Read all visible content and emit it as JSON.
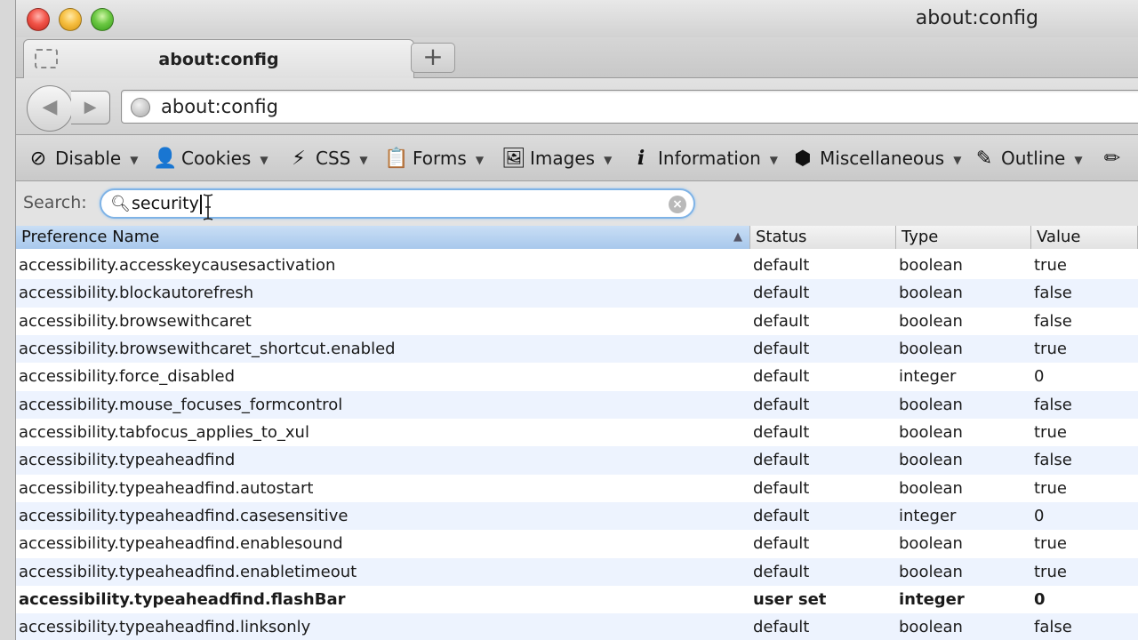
{
  "window": {
    "title": "about:config"
  },
  "tabs": [
    {
      "label": "about:config",
      "active": true
    }
  ],
  "new_tab_label": "+",
  "nav": {
    "back_glyph": "◀",
    "forward_glyph": "▶",
    "url": "about:config"
  },
  "dev_toolbar": {
    "items": [
      {
        "label": "Disable",
        "icon": "disable-icon"
      },
      {
        "label": "Cookies",
        "icon": "person-icon"
      },
      {
        "label": "CSS",
        "icon": "wand-icon"
      },
      {
        "label": "Forms",
        "icon": "clipboard-icon"
      },
      {
        "label": "Images",
        "icon": "image-icon"
      },
      {
        "label": "Information",
        "icon": "info-icon"
      },
      {
        "label": "Miscellaneous",
        "icon": "box-icon"
      },
      {
        "label": "Outline",
        "icon": "pencil-icon"
      }
    ]
  },
  "search": {
    "label": "Search:",
    "value": "security"
  },
  "table": {
    "columns": [
      "Preference Name",
      "Status",
      "Type",
      "Value"
    ],
    "rows": [
      {
        "name": "accessibility.accesskeycausesactivation",
        "status": "default",
        "type": "boolean",
        "value": "true"
      },
      {
        "name": "accessibility.blockautorefresh",
        "status": "default",
        "type": "boolean",
        "value": "false"
      },
      {
        "name": "accessibility.browsewithcaret",
        "status": "default",
        "type": "boolean",
        "value": "false"
      },
      {
        "name": "accessibility.browsewithcaret_shortcut.enabled",
        "status": "default",
        "type": "boolean",
        "value": "true"
      },
      {
        "name": "accessibility.force_disabled",
        "status": "default",
        "type": "integer",
        "value": "0"
      },
      {
        "name": "accessibility.mouse_focuses_formcontrol",
        "status": "default",
        "type": "boolean",
        "value": "false"
      },
      {
        "name": "accessibility.tabfocus_applies_to_xul",
        "status": "default",
        "type": "boolean",
        "value": "true"
      },
      {
        "name": "accessibility.typeaheadfind",
        "status": "default",
        "type": "boolean",
        "value": "false"
      },
      {
        "name": "accessibility.typeaheadfind.autostart",
        "status": "default",
        "type": "boolean",
        "value": "true"
      },
      {
        "name": "accessibility.typeaheadfind.casesensitive",
        "status": "default",
        "type": "integer",
        "value": "0"
      },
      {
        "name": "accessibility.typeaheadfind.enablesound",
        "status": "default",
        "type": "boolean",
        "value": "true"
      },
      {
        "name": "accessibility.typeaheadfind.enabletimeout",
        "status": "default",
        "type": "boolean",
        "value": "true"
      },
      {
        "name": "accessibility.typeaheadfind.flashBar",
        "status": "user set",
        "type": "integer",
        "value": "0"
      },
      {
        "name": "accessibility.typeaheadfind.linksonly",
        "status": "default",
        "type": "boolean",
        "value": "false"
      }
    ]
  },
  "colors": {
    "header_sorted": "#a8c8ec",
    "row_alt": "#edf3fe",
    "search_focus": "#7fb3e6"
  }
}
